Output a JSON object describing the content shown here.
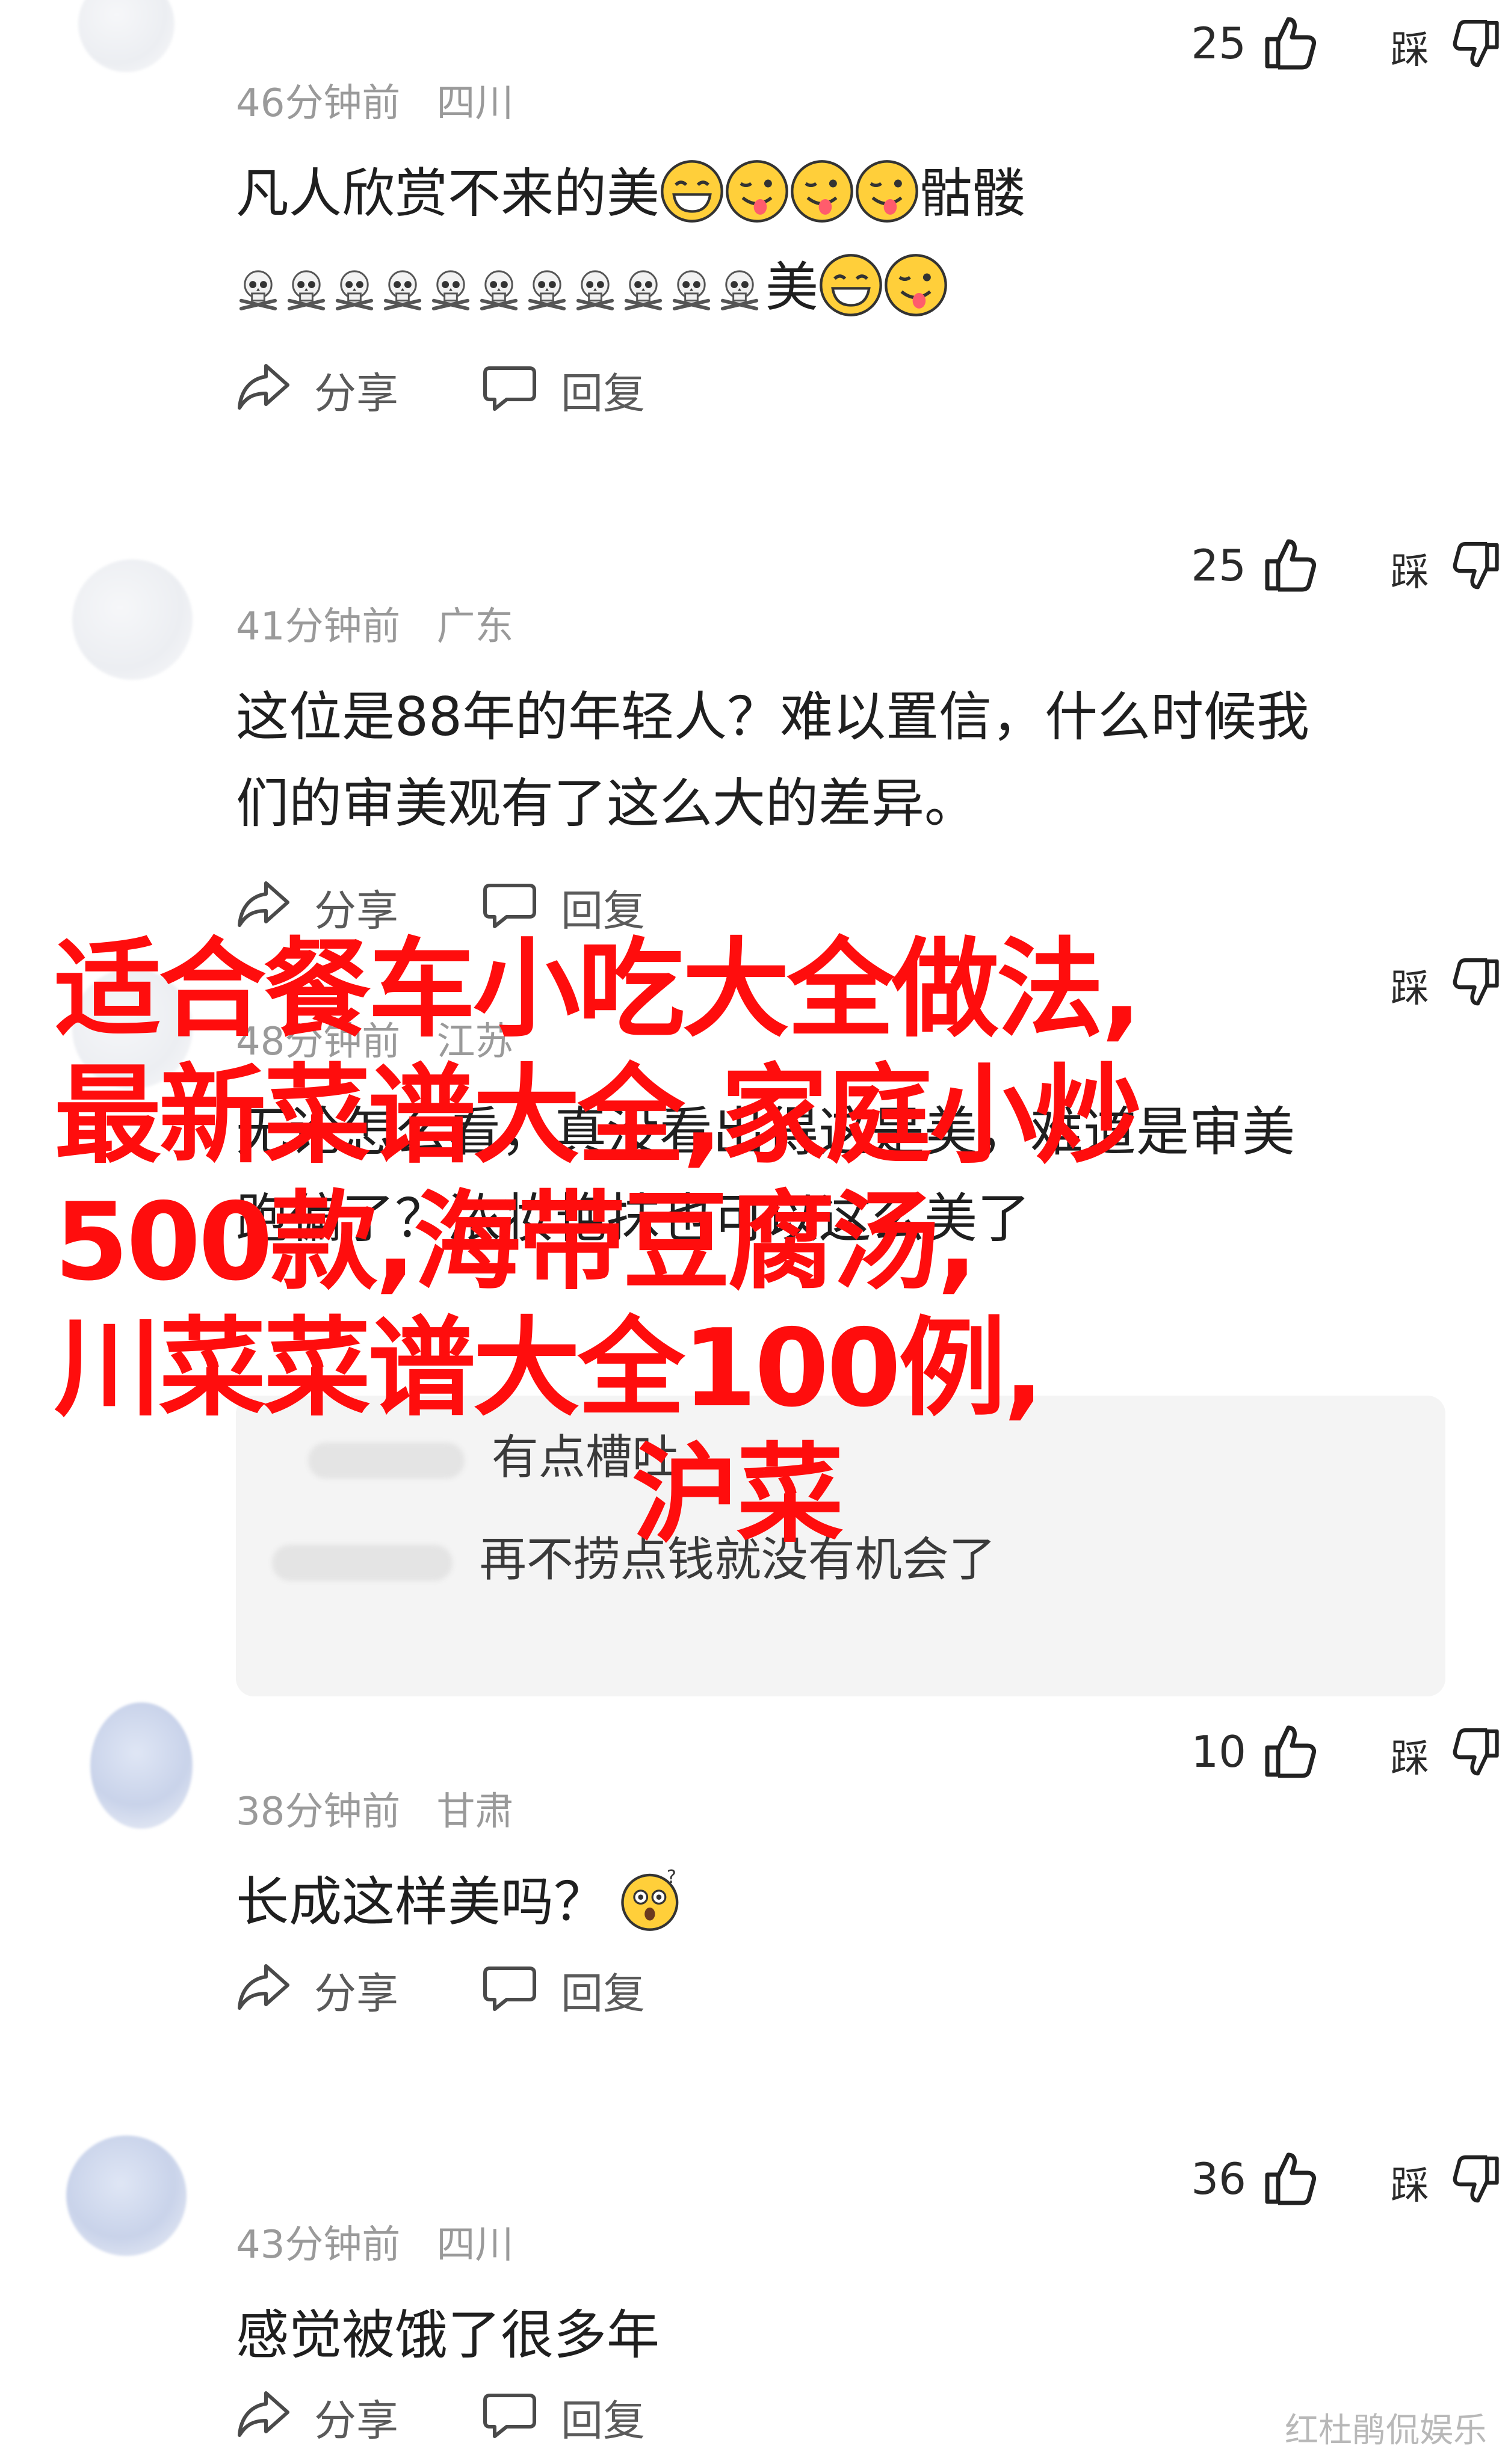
{
  "comments": [
    {
      "username": "",
      "time": "46分钟前",
      "region": "四川",
      "likes": "25",
      "dislike_label": "踩",
      "content_line1": "凡人欣赏不来的美",
      "content_line1_tail": "骷髅",
      "content_line2_tail": "美",
      "share_label": "分享",
      "reply_label": "回复"
    },
    {
      "username": "",
      "time": "41分钟前",
      "region": "广东",
      "likes": "25",
      "dislike_label": "踩",
      "content_line1": "这位是88年的年轻人？难以置信，什么时候我",
      "content_line2": "们的审美观有了这么大的差异。",
      "share_label": "分享",
      "reply_label": "回复"
    },
    {
      "username": "",
      "time": "48分钟前",
      "region": "江苏",
      "likes": "",
      "dislike_label": "踩",
      "content_line1": "无论怎么看，真没看出得这是美，难道是审美",
      "content_line2": "跑偏了？浓妆艳抹也可以这么美了",
      "share_label": "分享",
      "reply_label": "回复"
    },
    {
      "username": "",
      "time": "38分钟前",
      "region": "甘肃",
      "likes": "10",
      "dislike_label": "踩",
      "content_line1": "长成这样美吗？",
      "share_label": "分享",
      "reply_label": "回复"
    },
    {
      "username": "",
      "time": "43分钟前",
      "region": "四川",
      "likes": "36",
      "dislike_label": "踩",
      "content_line1": "感觉被饿了很多年",
      "share_label": "分享",
      "reply_label": "回复"
    }
  ],
  "replies": {
    "line1": "有点槽吐",
    "line2": "再不捞点钱就没有机会了"
  },
  "overlay": {
    "line1": "适合餐车小吃大全做法,",
    "line2": "最新菜谱大全,家庭小炒",
    "line3": "500款,海带豆腐汤,",
    "line4": "川菜菜谱大全100例,",
    "line5": "沪菜"
  },
  "watermark": "红杜鹃侃娱乐",
  "colors": {
    "overlay_text": "#ff0d0d",
    "meta_text": "#9a9a9a",
    "reply_bg": "#f4f4f4"
  }
}
